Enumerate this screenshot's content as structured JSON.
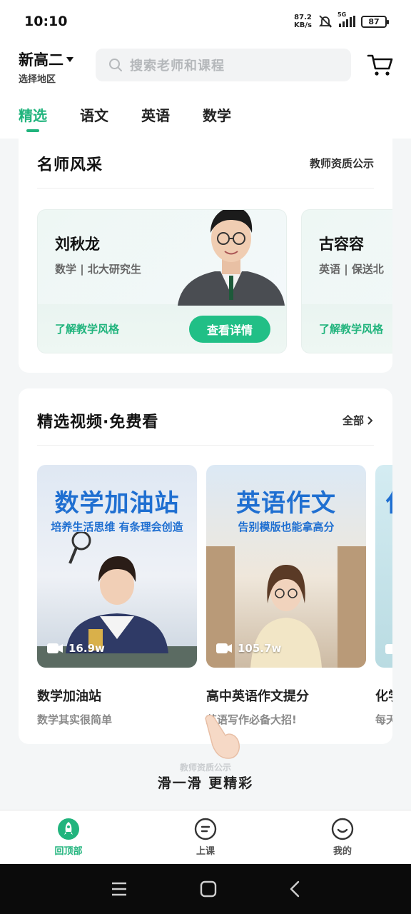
{
  "status_bar": {
    "time": "10:10",
    "net_speed_value": "87.2",
    "net_speed_unit": "KB/s",
    "network_type": "5G",
    "battery": "87"
  },
  "header": {
    "grade": "新高二",
    "region": "选择地区",
    "search_placeholder": "搜索老师和课程"
  },
  "tabs": [
    {
      "label": "精选",
      "active": true
    },
    {
      "label": "语文",
      "active": false
    },
    {
      "label": "英语",
      "active": false
    },
    {
      "label": "数学",
      "active": false
    }
  ],
  "teachers_section": {
    "title": "名师风采",
    "link": "教师资质公示",
    "teachers": [
      {
        "name": "刘秋龙",
        "desc": "数学 | 北大研究生",
        "style_link": "了解教学风格",
        "button": "查看详情"
      },
      {
        "name": "古容容",
        "desc": "英语 | 保送北",
        "style_link": "了解教学风格"
      }
    ]
  },
  "videos_section": {
    "title": "精选视频·免费看",
    "link": "全部",
    "videos": [
      {
        "thumb_title": "数学加油站",
        "thumb_subtitle": "培养生活思维 有条理会创造",
        "views": "16.9w",
        "title": "数学加油站",
        "subtitle": "数学其实很简单"
      },
      {
        "thumb_title": "英语作文",
        "thumb_subtitle": "告别模版也能拿高分",
        "views": "105.7w",
        "title": "高中英语作文提分",
        "subtitle": "英语写作必备大招!"
      },
      {
        "thumb_title": "化",
        "thumb_subtitle": "",
        "views": "",
        "title": "化学",
        "subtitle": "每天"
      }
    ]
  },
  "swipe_hint": {
    "faded_text": "教师资质公示",
    "text": "滑一滑 更精彩"
  },
  "bottom_nav": [
    {
      "label": "回顶部",
      "icon": "rocket-icon",
      "active": true
    },
    {
      "label": "上课",
      "icon": "class-icon",
      "active": false
    },
    {
      "label": "我的",
      "icon": "profile-icon",
      "active": false
    }
  ],
  "colors": {
    "accent": "#21b47d",
    "button": "#21bf86",
    "thumb_title": "#1f6fd1"
  }
}
